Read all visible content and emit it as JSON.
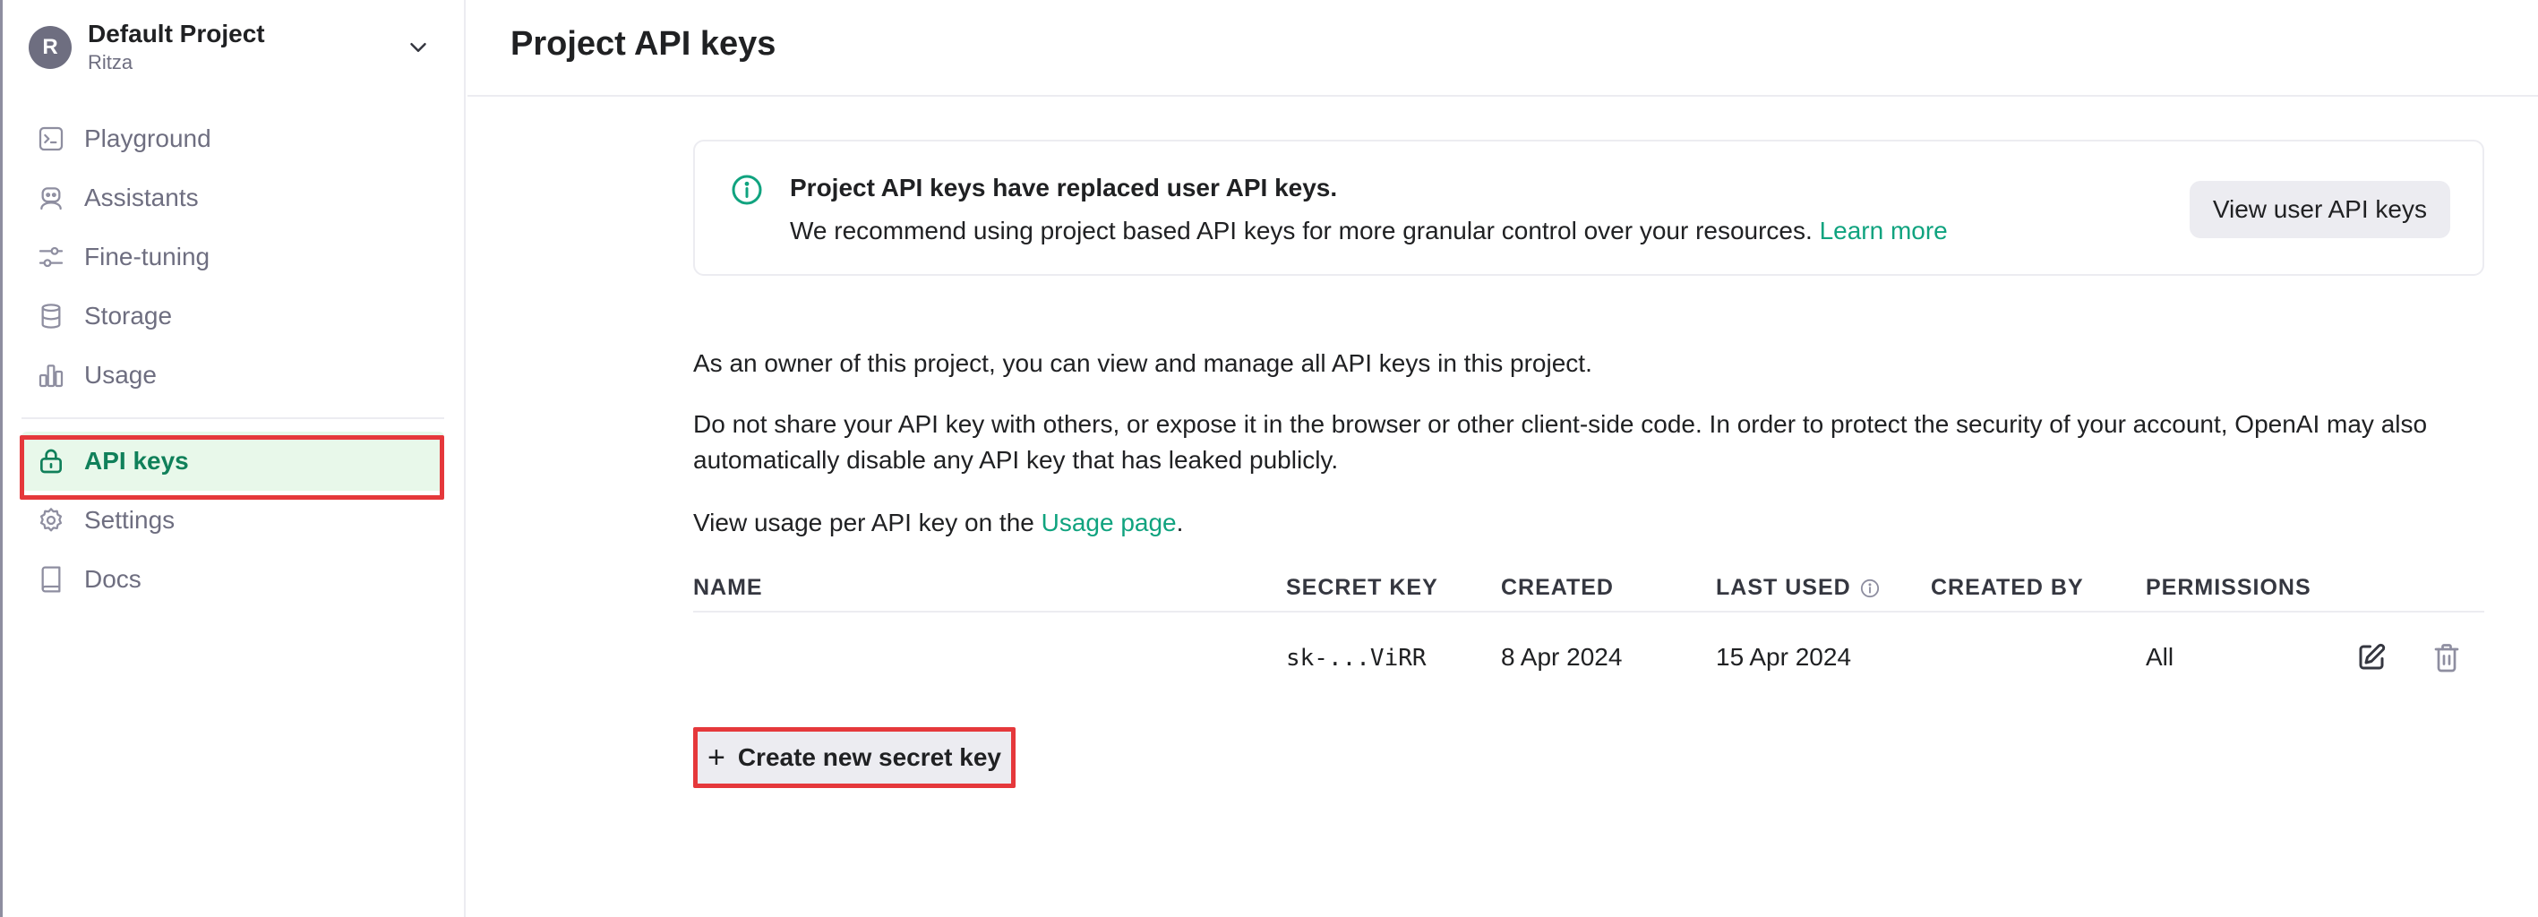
{
  "sidebar": {
    "project": {
      "avatar_letter": "R",
      "name": "Default Project",
      "org": "Ritza"
    },
    "items": [
      {
        "label": "Playground",
        "icon": "terminal-icon"
      },
      {
        "label": "Assistants",
        "icon": "robot-icon"
      },
      {
        "label": "Fine-tuning",
        "icon": "sliders-icon"
      },
      {
        "label": "Storage",
        "icon": "database-icon"
      },
      {
        "label": "Usage",
        "icon": "bar-chart-icon"
      },
      {
        "label": "API keys",
        "icon": "lock-icon",
        "active": true
      },
      {
        "label": "Settings",
        "icon": "gear-icon"
      },
      {
        "label": "Docs",
        "icon": "book-icon"
      }
    ]
  },
  "header": {
    "title": "Project API keys"
  },
  "notice": {
    "title": "Project API keys have replaced user API keys.",
    "body": "We recommend using project based API keys for more granular control over your resources.",
    "link": "Learn more",
    "button": "View user API keys"
  },
  "main": {
    "para1": "As an owner of this project, you can view and manage all API keys in this project.",
    "para2": "Do not share your API key with others, or expose it in the browser or other client-side code. In order to protect the security of your account, OpenAI may also automatically disable any API key that has leaked publicly.",
    "para3_prefix": "View usage per API key on the ",
    "para3_link": "Usage page",
    "para3_suffix": "."
  },
  "table": {
    "columns": [
      "NAME",
      "SECRET KEY",
      "CREATED",
      "LAST USED",
      "CREATED BY",
      "PERMISSIONS"
    ],
    "rows": [
      {
        "name": "",
        "secret_key": "sk-...ViRR",
        "created": "8 Apr 2024",
        "last_used": "15 Apr 2024",
        "created_by": "",
        "permissions": "All"
      }
    ]
  },
  "actions": {
    "create": "Create new secret key"
  },
  "colors": {
    "accent": "#10a37f",
    "active_bg": "#e8f8ea",
    "highlight": "#e5383b"
  }
}
